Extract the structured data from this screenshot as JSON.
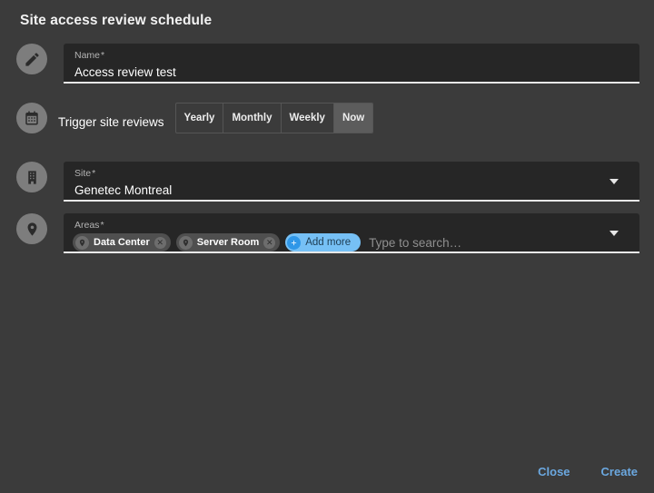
{
  "dialog": {
    "title": "Site access review schedule"
  },
  "fields": {
    "name": {
      "icon": "pencil-icon",
      "label": "Name",
      "required_marker": "*",
      "value": "Access review test"
    },
    "trigger": {
      "icon": "calendar-icon",
      "label": "Trigger site reviews",
      "options": [
        {
          "label": "Yearly",
          "selected": false
        },
        {
          "label": "Monthly",
          "selected": false
        },
        {
          "label": "Weekly",
          "selected": false
        },
        {
          "label": "Now",
          "selected": true
        }
      ],
      "selected": "Now"
    },
    "site": {
      "icon": "building-icon",
      "label": "Site",
      "required_marker": "*",
      "value": "Genetec Montreal",
      "caret": "chevron-down-icon"
    },
    "areas": {
      "icon": "location-pin-icon",
      "label": "Areas",
      "required_marker": "*",
      "chips": [
        {
          "label": "Data Center",
          "icon": "location-pin-icon",
          "close": "✕"
        },
        {
          "label": "Server Room",
          "icon": "location-pin-icon",
          "close": "✕"
        }
      ],
      "add_more": {
        "label": "Add more",
        "icon": "plus-icon"
      },
      "placeholder": "Type to search…",
      "caret": "chevron-down-icon"
    }
  },
  "footer": {
    "close_label": "Close",
    "create_label": "Create"
  },
  "colors": {
    "background": "#3b3b3b",
    "field_background": "#262626",
    "field_underline": "#e8e8e8",
    "accent_link": "#6ba8e0",
    "chip_add_background": "#76c0f5",
    "segment_selected": "#5c5c5c"
  }
}
